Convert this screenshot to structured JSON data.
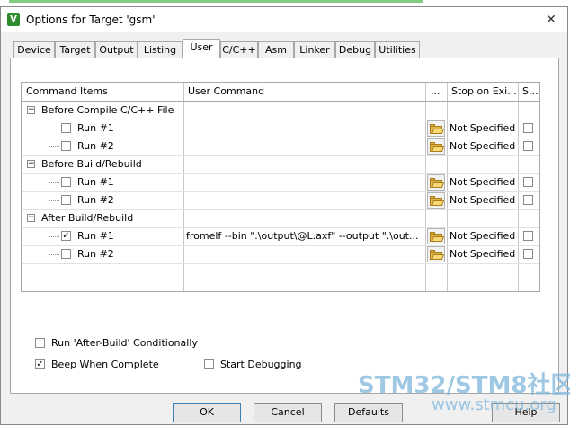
{
  "window": {
    "title": "Options for Target 'gsm'",
    "icon_letter": "V",
    "close_glyph": "✕"
  },
  "tabs": [
    {
      "label": "Device",
      "active": false
    },
    {
      "label": "Target",
      "active": false
    },
    {
      "label": "Output",
      "active": false
    },
    {
      "label": "Listing",
      "active": false
    },
    {
      "label": "User",
      "active": true
    },
    {
      "label": "C/C++",
      "active": false
    },
    {
      "label": "Asm",
      "active": false
    },
    {
      "label": "Linker",
      "active": false
    },
    {
      "label": "Debug",
      "active": false
    },
    {
      "label": "Utilities",
      "active": false
    }
  ],
  "grid": {
    "headers": {
      "command_items": "Command Items",
      "user_command": "User Command",
      "browse": "...",
      "stop_on_exit": "Stop on Exi...",
      "s": "S..."
    },
    "groups": [
      {
        "label": "Before Compile C/C++ File",
        "expander": "−",
        "runs": [
          {
            "label": "Run #1",
            "checked": false,
            "command": "",
            "status": "Not Specified",
            "s_checked": false
          },
          {
            "label": "Run #2",
            "checked": false,
            "command": "",
            "status": "Not Specified",
            "s_checked": false
          }
        ]
      },
      {
        "label": "Before Build/Rebuild",
        "expander": "−",
        "runs": [
          {
            "label": "Run #1",
            "checked": false,
            "command": "",
            "status": "Not Specified",
            "s_checked": false
          },
          {
            "label": "Run #2",
            "checked": false,
            "command": "",
            "status": "Not Specified",
            "s_checked": false
          }
        ]
      },
      {
        "label": "After Build/Rebuild",
        "expander": "−",
        "runs": [
          {
            "label": "Run #1",
            "checked": true,
            "command": "fromelf --bin \".\\output\\@L.axf\" --output \".\\out...",
            "status": "Not Specified",
            "s_checked": false
          },
          {
            "label": "Run #2",
            "checked": false,
            "command": "",
            "status": "Not Specified",
            "s_checked": false
          }
        ]
      }
    ]
  },
  "options": {
    "run_after_build": {
      "label": "Run 'After-Build' Conditionally",
      "checked": false
    },
    "beep_when_complete": {
      "label": "Beep When Complete",
      "checked": true
    },
    "start_debugging": {
      "label": "Start Debugging",
      "checked": false
    }
  },
  "buttons": {
    "ok": "OK",
    "cancel": "Cancel",
    "defaults": "Defaults",
    "help": "Help"
  },
  "watermark": {
    "line1": "STM32/STM8社区",
    "line2": "www.stmcu.org"
  },
  "glyphs": {
    "check": "✓"
  },
  "colors": {
    "accent": "#3c7fb1",
    "watermark": "#7fb6dc",
    "folder": "#e0b445"
  }
}
